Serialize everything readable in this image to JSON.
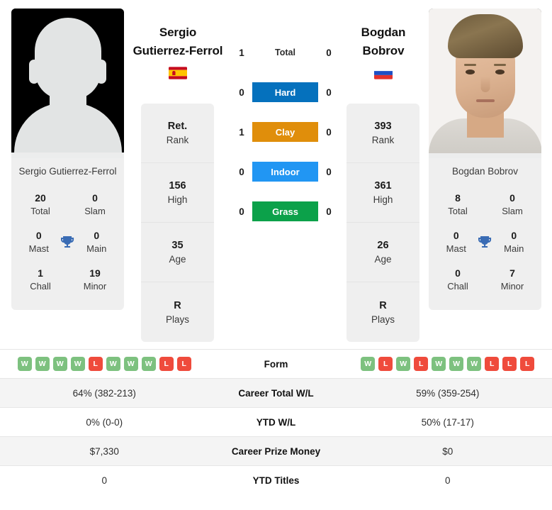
{
  "players": {
    "left": {
      "first_name": "Sergio",
      "last_name": "Gutierrez-Ferrol",
      "full_name": "Sergio Gutierrez-Ferrol",
      "country": "Spain",
      "flag_icon": "flag-spain-icon",
      "photo_icon": "player-silhouette-placeholder",
      "titles": {
        "total_value": "20",
        "total_label": "Total",
        "slam_value": "0",
        "slam_label": "Slam",
        "mast_value": "0",
        "mast_label": "Mast",
        "main_value": "0",
        "main_label": "Main",
        "chall_value": "1",
        "chall_label": "Chall",
        "minor_value": "19",
        "minor_label": "Minor"
      },
      "attributes": [
        {
          "value": "Ret.",
          "label": "Rank"
        },
        {
          "value": "156",
          "label": "High"
        },
        {
          "value": "35",
          "label": "Age"
        },
        {
          "value": "R",
          "label": "Plays"
        }
      ],
      "form": [
        "W",
        "W",
        "W",
        "W",
        "L",
        "W",
        "W",
        "W",
        "L",
        "L"
      ],
      "career_total_wl": "64% (382-213)",
      "ytd_wl": "0% (0-0)",
      "career_prize_money": "$7,330",
      "ytd_titles": "0"
    },
    "right": {
      "first_name": "Bogdan",
      "last_name": "Bobrov",
      "full_name": "Bogdan Bobrov",
      "country": "Russia",
      "flag_icon": "flag-russia-icon",
      "photo_icon": "player-portrait-photo",
      "titles": {
        "total_value": "8",
        "total_label": "Total",
        "slam_value": "0",
        "slam_label": "Slam",
        "mast_value": "0",
        "mast_label": "Mast",
        "main_value": "0",
        "main_label": "Main",
        "chall_value": "0",
        "chall_label": "Chall",
        "minor_value": "7",
        "minor_label": "Minor"
      },
      "attributes": [
        {
          "value": "393",
          "label": "Rank"
        },
        {
          "value": "361",
          "label": "High"
        },
        {
          "value": "26",
          "label": "Age"
        },
        {
          "value": "R",
          "label": "Plays"
        }
      ],
      "form": [
        "W",
        "L",
        "W",
        "L",
        "W",
        "W",
        "W",
        "L",
        "L",
        "L"
      ],
      "career_total_wl": "59% (359-254)",
      "ytd_wl": "50% (17-17)",
      "career_prize_money": "$0",
      "ytd_titles": "0"
    }
  },
  "surfaces": [
    {
      "name": "Total",
      "left_score": "1",
      "right_score": "0",
      "color": "transparent",
      "text_color": "#2b2b2b",
      "filled": false
    },
    {
      "name": "Hard",
      "left_score": "0",
      "right_score": "0",
      "color": "#0571bd",
      "text_color": "#ffffff",
      "filled": true
    },
    {
      "name": "Clay",
      "left_score": "1",
      "right_score": "0",
      "color": "#e08e0b",
      "text_color": "#ffffff",
      "filled": true
    },
    {
      "name": "Indoor",
      "left_score": "0",
      "right_score": "0",
      "color": "#2196f3",
      "text_color": "#ffffff",
      "filled": true
    },
    {
      "name": "Grass",
      "left_score": "0",
      "right_score": "0",
      "color": "#0ca14a",
      "text_color": "#ffffff",
      "filled": true
    }
  ],
  "comparison_rows": [
    {
      "label": "Form",
      "left": "",
      "right": ""
    },
    {
      "label": "Career Total W/L",
      "left": "64% (382-213)",
      "right": "59% (359-254)"
    },
    {
      "label": "YTD W/L",
      "left": "0% (0-0)",
      "right": "50% (17-17)"
    },
    {
      "label": "Career Prize Money",
      "left": "$7,330",
      "right": "$0"
    },
    {
      "label": "YTD Titles",
      "left": "0",
      "right": "0"
    }
  ],
  "colors": {
    "win_badge": "#7dc17f",
    "loss_badge": "#ef4b3c",
    "panel": "#efefef",
    "row_alt": "#f4f4f4",
    "trophy": "#3a6cb4"
  },
  "icons": {
    "trophy": "trophy-icon"
  }
}
